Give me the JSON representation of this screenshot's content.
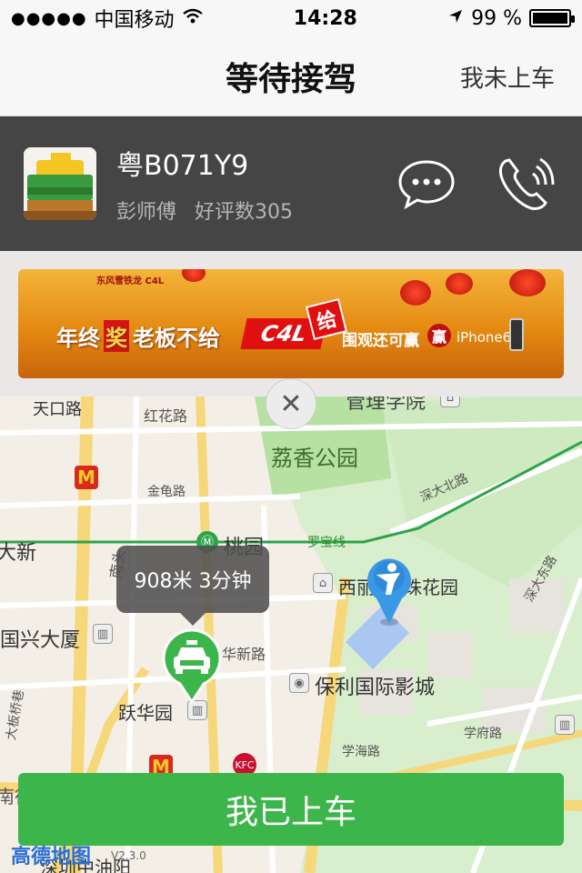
{
  "status_bar": {
    "signal_dots": "●●●●●",
    "carrier": "中国移动",
    "wifi_icon": "wifi-icon",
    "time": "14:28",
    "location_icon": "location-arrow-icon",
    "battery_percent": "99 %",
    "battery_level": 0.99
  },
  "nav": {
    "title": "等待接驾",
    "right_action": "我未上车"
  },
  "driver": {
    "plate": "粤B071Y9",
    "name": "彭师傅",
    "rating": "好评数305",
    "avatar_icon": "taxi-icon",
    "message_icon": "message-bubble-icon",
    "phone_icon": "phone-icon"
  },
  "ad": {
    "brand": "东风雪铁龙 C4L",
    "headline_prefix": "年终",
    "headline_char": "奖",
    "headline_suffix": "老板不给",
    "c4l": "C4L",
    "gives": "给",
    "sub": "围观还可赢",
    "iphone": "iPhone6"
  },
  "map": {
    "close_icon": "close-icon",
    "labels": {
      "guanli": "管理学院",
      "tiankou": "天口路",
      "honghua": "红花路",
      "lixiang": "荔香公园",
      "shenda": "深大北路",
      "jinguilu": "金龟路",
      "taoyuan": "桃园",
      "luobao": "罗宝线",
      "daxin": "大新",
      "nantou": "南头",
      "xili": "西丽",
      "zhuhua": "珠花园",
      "shendadong": "深大东路",
      "guoxing": "国兴大厦",
      "huaxin": "华新路",
      "baoli": "保利国际影城",
      "yuehua": "跃华园",
      "xuefu": "学府路",
      "xuehai": "学海路",
      "shenzhen": "深圳中油阳",
      "dadeng": "大板桥巷",
      "nande": "南德"
    },
    "eta": "908米 3分钟",
    "taxi_pin_icon": "taxi-pin-icon",
    "user_pin_icon": "user-location-pin-icon",
    "logo": "高德地图",
    "version": "V2.3.0"
  },
  "action": {
    "board_label": "我已上车"
  },
  "colors": {
    "accent_green": "#3cb64a",
    "panel_dark": "#454545"
  }
}
